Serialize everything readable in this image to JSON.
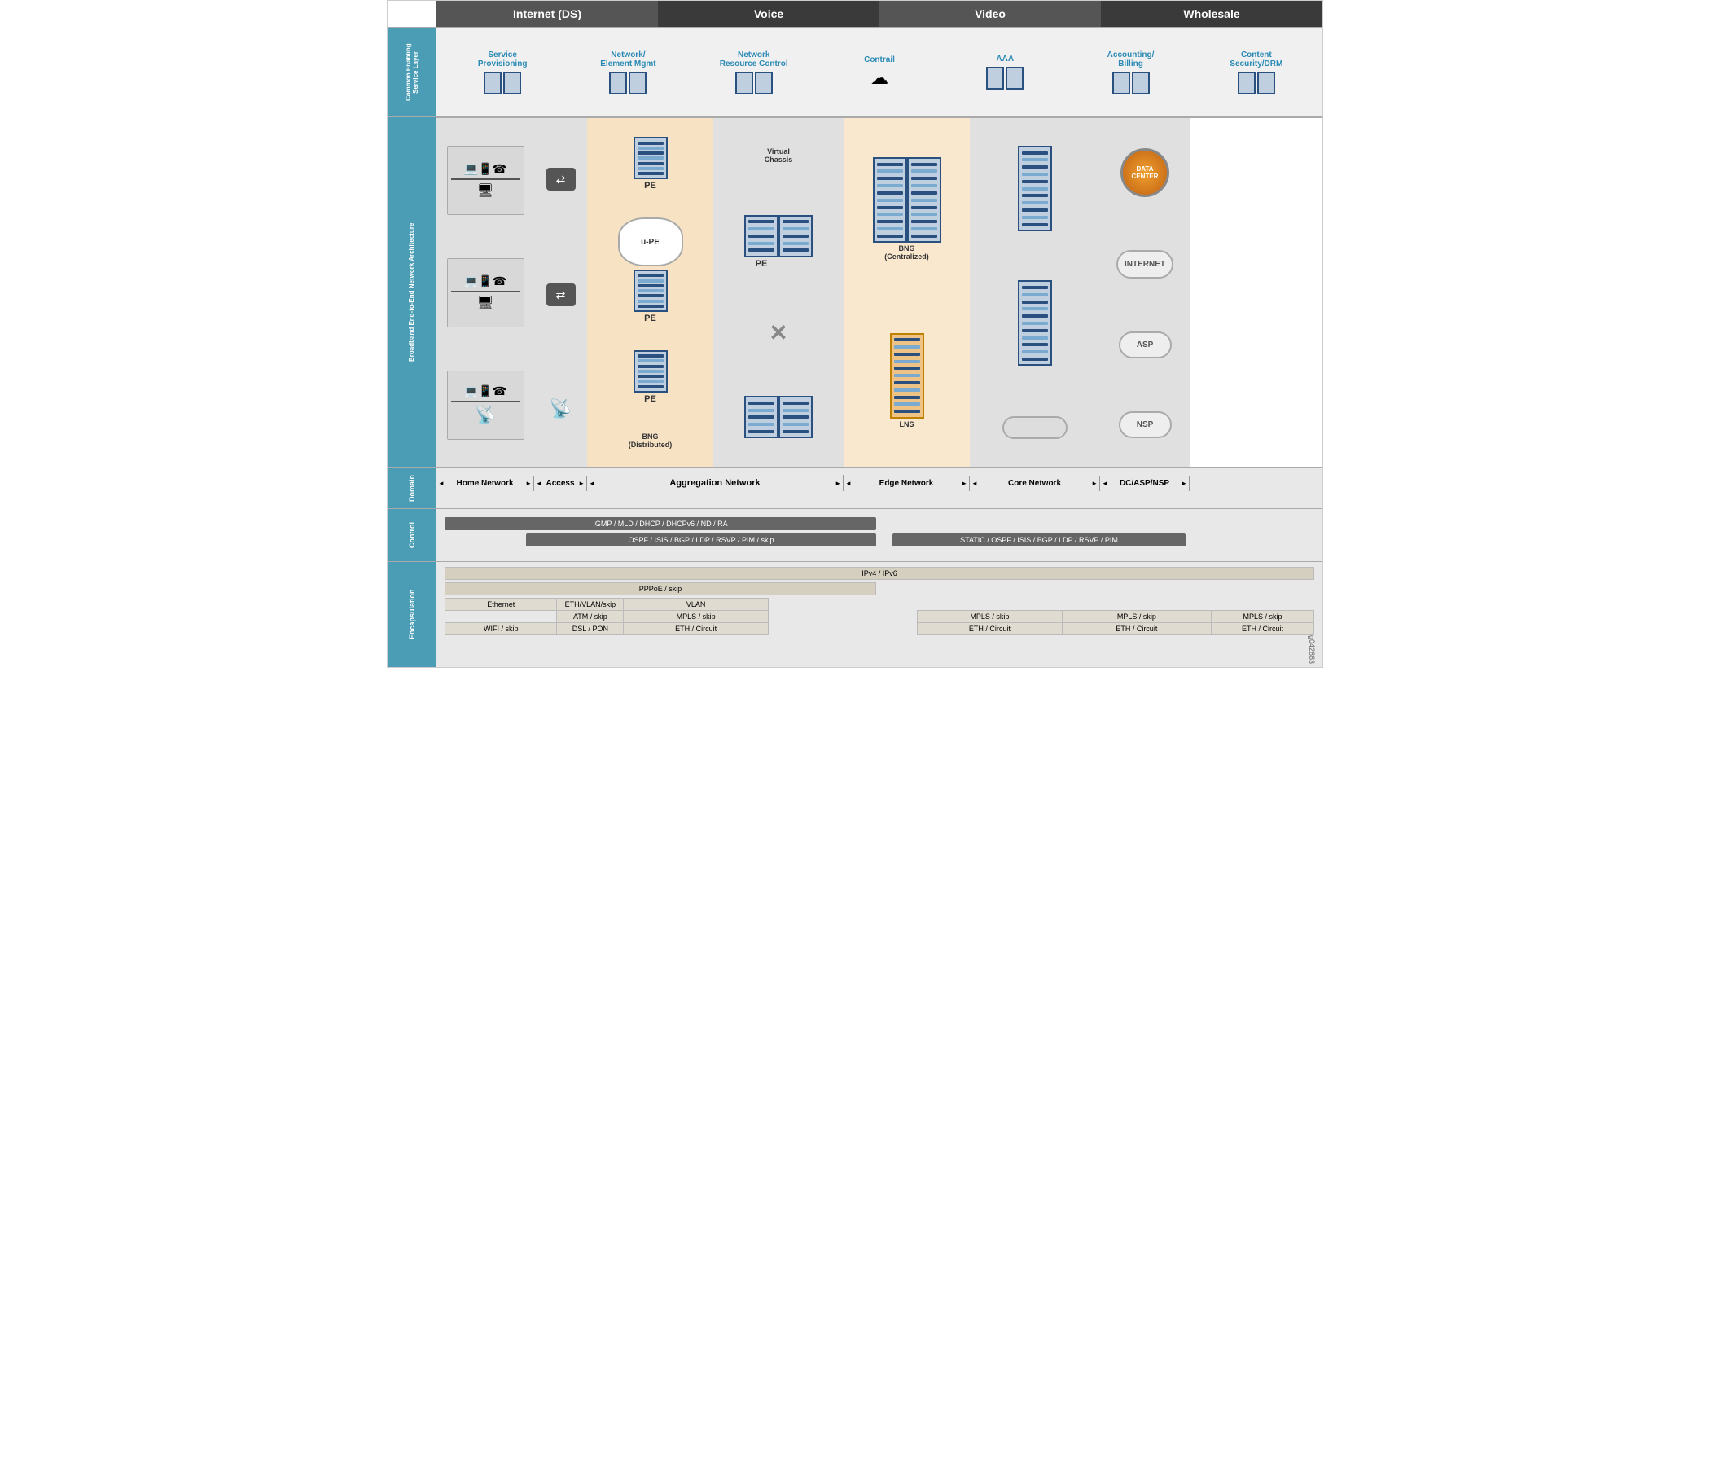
{
  "header": {
    "columns": [
      {
        "label": "Internet (DS)",
        "class": "col-internet"
      },
      {
        "label": "Voice",
        "class": "col-voice"
      },
      {
        "label": "Video",
        "class": "col-video"
      },
      {
        "label": "Wholesale",
        "class": "col-wholesale"
      }
    ]
  },
  "sections": {
    "cesl": {
      "label": "Common Enabling\nService Layer",
      "items": [
        {
          "label": "Service\nProvisioning",
          "icon": "🖥"
        },
        {
          "label": "Network/\nElement Mgmt",
          "icon": "🖥"
        },
        {
          "label": "Network\nResource Control",
          "icon": "🖥"
        },
        {
          "label": "Contrail",
          "icon": "☁"
        },
        {
          "label": "AAA",
          "icon": "🖥"
        },
        {
          "label": "Accounting/\nBilling",
          "icon": "🖥"
        },
        {
          "label": "Content\nSecurity/DRM",
          "icon": "🖥"
        }
      ]
    },
    "broadband": {
      "label": "Broadband End-to-End Network Architecture"
    },
    "domain": {
      "label": "Domain",
      "segments": [
        {
          "label": "Home Network",
          "width": 120
        },
        {
          "label": "Access",
          "width": 65
        },
        {
          "label": "Aggregation Network",
          "width": 155
        },
        {
          "label": "",
          "width": 50
        },
        {
          "label": "Edge Network",
          "width": 155
        },
        {
          "label": "Core Network",
          "width": 160
        },
        {
          "label": "DC/ASP/NSP",
          "width": 110
        }
      ]
    },
    "control": {
      "label": "Control",
      "bars": [
        {
          "text": "IGMP / MLD / DHCP / DHCPv6 / ND / RA",
          "span": "home-to-agg"
        },
        {
          "text": "OSPF / ISIS / BGP / LDP / RSVP / PIM / skip",
          "span": "agg-to-edge"
        },
        {
          "text": "STATIC / OSPF / ISIS / BGP / LDP / RSVP / PIM",
          "span": "core"
        }
      ]
    },
    "encapsulation": {
      "label": "Encapsulation",
      "row_ipv": "IPv4 / IPv6",
      "row_pppoe": "PPPoE / skip",
      "rows": [
        {
          "home": "Ethernet",
          "access": "ETH/VLAN/skip",
          "agg": "VLAN",
          "edge": "",
          "core": "",
          "dc": ""
        },
        {
          "home": "",
          "access": "ATM / skip",
          "agg": "MPLS / skip",
          "edge": "MPLS / skip",
          "core": "MPLS / skip",
          "dc": "MPLS / skip"
        },
        {
          "home": "WIFI / skip",
          "access": "DSL / PON",
          "agg": "ETH / Circuit",
          "edge": "ETH / Circuit",
          "core": "ETH / Circuit",
          "dc": "ETH / Circuit"
        }
      ]
    }
  },
  "diagram": {
    "pe_labels": [
      "PE",
      "PE",
      "PE"
    ],
    "u_pe_label": "u-PE",
    "vc_label": "Virtual\nChassis",
    "bng_dist_label": "BNG\n(Distributed)",
    "bng_cent_label": "BNG\n(Centralized)",
    "lns_label": "LNS",
    "data_center_label": "DATA\nCENTER",
    "internet_label": "INTERNET",
    "asp_label": "ASP",
    "nsp_label": "NSP"
  },
  "figure_number": "g042863"
}
